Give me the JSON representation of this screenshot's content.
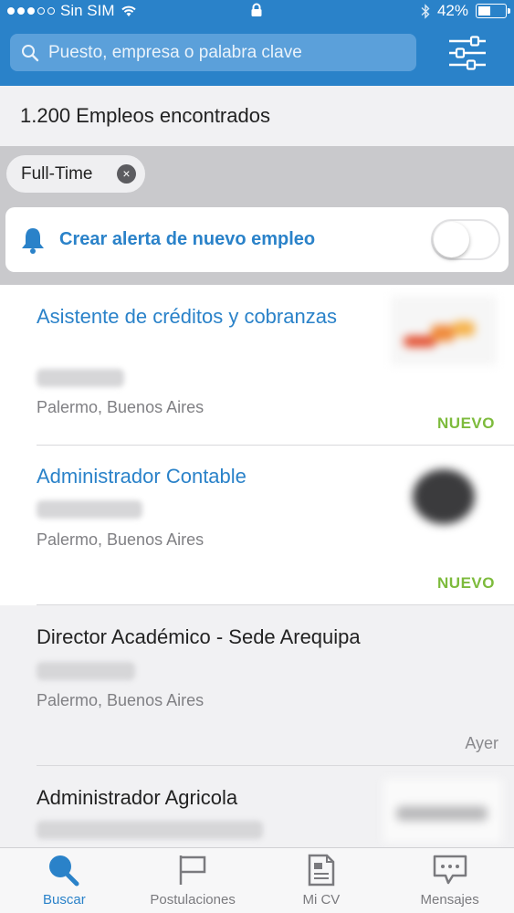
{
  "status_bar": {
    "carrier": "Sin SIM",
    "battery_percent": "42%",
    "battery_level": 0.42
  },
  "search": {
    "placeholder": "Puesto, empresa o palabra clave",
    "icon": "search-icon"
  },
  "filter_button_icon": "sliders-icon",
  "results": {
    "count_text": "1.200 Empleos encontrados"
  },
  "chips": [
    {
      "label": "Full-Time",
      "remove_symbol": "×"
    }
  ],
  "alert": {
    "label": "Crear alerta de nuevo empleo",
    "enabled": false,
    "accent_color": "#2a82c9"
  },
  "jobs": [
    {
      "title": "Asistente de créditos y cobranzas",
      "location": "Palermo, Buenos Aires",
      "badge": "NUEVO",
      "date": "",
      "viewed": false
    },
    {
      "title": "Administrador Contable",
      "location": "Palermo, Buenos Aires",
      "badge": "NUEVO",
      "date": "",
      "viewed": false
    },
    {
      "title": "Director Académico - Sede Arequipa",
      "location": "Palermo, Buenos Aires",
      "badge": "",
      "date": "Ayer",
      "viewed": true
    },
    {
      "title": "Administrador Agricola",
      "location": "",
      "badge": "",
      "date": "",
      "viewed": true
    }
  ],
  "colors": {
    "brand_blue": "#2a82c9",
    "new_badge_green": "#7dbb3c"
  },
  "tabs": [
    {
      "label": "Buscar",
      "icon": "search-icon",
      "active": true
    },
    {
      "label": "Postulaciones",
      "icon": "flag-icon",
      "active": false
    },
    {
      "label": "Mi CV",
      "icon": "document-icon",
      "active": false
    },
    {
      "label": "Mensajes",
      "icon": "chat-bubble-icon",
      "active": false
    }
  ]
}
